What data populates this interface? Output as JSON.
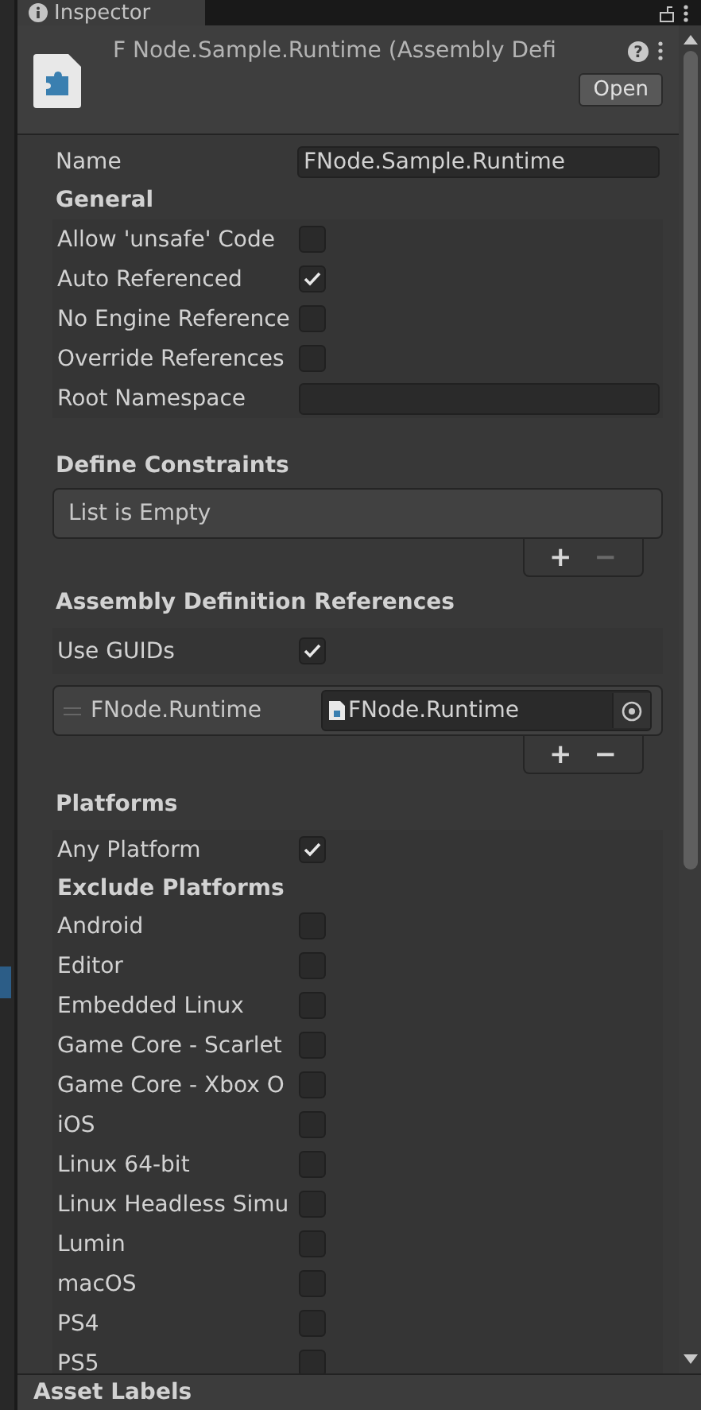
{
  "tab": {
    "title": "Inspector"
  },
  "header": {
    "title": "F Node.Sample.Runtime (Assembly Defi",
    "open_button": "Open",
    "help_glyph": "?"
  },
  "name_field": {
    "label": "Name",
    "value": "FNode.Sample.Runtime"
  },
  "general": {
    "title": "General",
    "rows": [
      {
        "kind": "checkbox",
        "label": "Allow 'unsafe' Code",
        "checked": false
      },
      {
        "kind": "checkbox",
        "label": "Auto Referenced",
        "checked": true
      },
      {
        "kind": "checkbox",
        "label": "No Engine Reference",
        "checked": false
      },
      {
        "kind": "checkbox",
        "label": "Override References",
        "checked": false
      },
      {
        "kind": "text",
        "label": "Root Namespace"
      }
    ]
  },
  "define_constraints": {
    "title": "Define Constraints",
    "empty_text": "List is Empty",
    "buttons": [
      {
        "label": "+",
        "disabled": false
      },
      {
        "label": "−",
        "disabled": true
      }
    ]
  },
  "references": {
    "title": "Assembly Definition References",
    "use_guids": {
      "label": "Use GUIDs",
      "checked": true
    },
    "items": [
      {
        "name": "FNode.Runtime",
        "value": "FNode.Runtime"
      }
    ],
    "buttons": [
      {
        "label": "+",
        "disabled": false
      },
      {
        "label": "−",
        "disabled": false
      }
    ]
  },
  "platforms": {
    "title": "Platforms",
    "any_platform": {
      "label": "Any Platform",
      "checked": true
    },
    "exclude_title": "Exclude Platforms",
    "items": [
      {
        "label": "Android",
        "checked": false
      },
      {
        "label": "Editor",
        "checked": false
      },
      {
        "label": "Embedded Linux",
        "checked": false
      },
      {
        "label": "Game Core - Scarlet",
        "checked": false
      },
      {
        "label": "Game Core - Xbox O",
        "checked": false
      },
      {
        "label": "iOS",
        "checked": false
      },
      {
        "label": "Linux 64-bit",
        "checked": false
      },
      {
        "label": "Linux Headless Simu",
        "checked": false
      },
      {
        "label": "Lumin",
        "checked": false
      },
      {
        "label": "macOS",
        "checked": false
      },
      {
        "label": "PS4",
        "checked": false
      },
      {
        "label": "PS5",
        "checked": false
      }
    ]
  },
  "footer": {
    "title": "Asset Labels"
  }
}
